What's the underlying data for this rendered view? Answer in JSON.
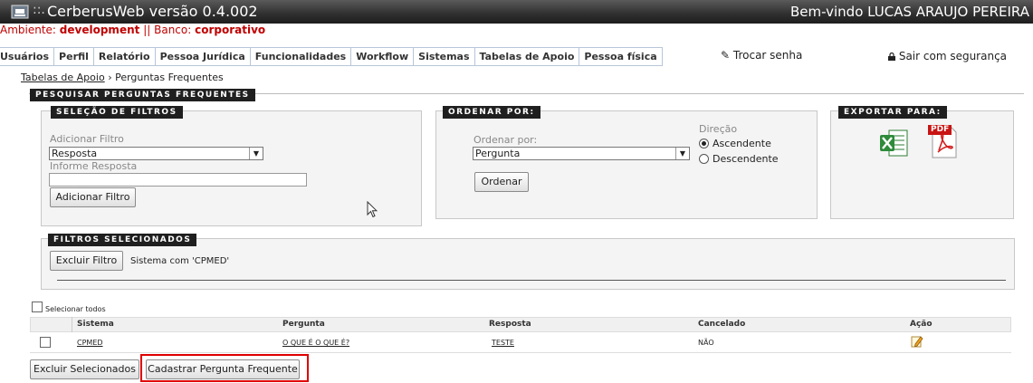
{
  "header": {
    "separator": "::.",
    "title": "CerberusWeb versão 0.4.002",
    "welcome": "Bem-vindo LUCAS ARAUJO PEREIRA"
  },
  "env": {
    "ambiente_label": "Ambiente:",
    "ambiente_value": "development",
    "divider": "||",
    "banco_label": "Banco:",
    "banco_value": "corporativo"
  },
  "menu": {
    "items": [
      "Usuários",
      "Perfil",
      "Relatório",
      "Pessoa Jurídica",
      "Funcionalidades",
      "Workflow",
      "Sistemas",
      "Tabelas de Apoio",
      "Pessoa física"
    ]
  },
  "account": {
    "trocar_senha": "Trocar senha",
    "sair": "Sair com segurança"
  },
  "breadcrumb": {
    "parent": "Tabelas de Apoio",
    "sep": "›",
    "current": "Perguntas Frequentes"
  },
  "search": {
    "section_title": "PESQUISAR PERGUNTAS FREQUENTES",
    "filters": {
      "title": "SELEÇÃO DE FILTROS",
      "add_label": "Adicionar Filtro",
      "select_value": "Resposta",
      "input_label": "Informe Resposta",
      "input_value": "",
      "add_button": "Adicionar Filtro"
    },
    "order": {
      "title": "ORDENAR POR:",
      "order_label": "Ordenar por:",
      "order_value": "Pergunta",
      "direction_label": "Direção",
      "asc": "Ascendente",
      "desc": "Descendente",
      "button": "Ordenar"
    },
    "export": {
      "title": "EXPORTAR PARA:",
      "pdf_text": "PDF"
    },
    "selected": {
      "title": "FILTROS SELECIONADOS",
      "remove_button": "Excluir Filtro",
      "filter_text": "Sistema com 'CPMED'"
    }
  },
  "table": {
    "select_all": "Selecionar todos",
    "columns": [
      "Sistema",
      "Pergunta",
      "Resposta",
      "Cancelado",
      "Ação"
    ],
    "rows": [
      {
        "sistema": "CPMED",
        "pergunta": "O QUE É O QUE É?",
        "resposta": "TESTE",
        "cancelado": "NÃO"
      }
    ]
  },
  "actions": {
    "delete_selected": "Excluir Selecionados",
    "register": "Cadastrar Pergunta Frequente"
  },
  "colors": {
    "accent_red": "#e00000",
    "env_red": "#c00000",
    "header_dark": "#2f2f2f"
  }
}
